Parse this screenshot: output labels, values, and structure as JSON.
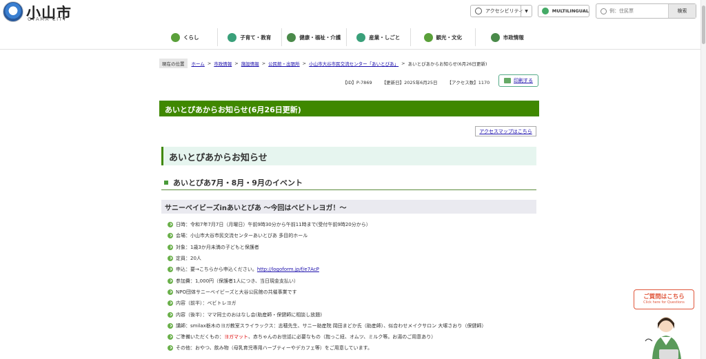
{
  "header": {
    "site_name": "小山市",
    "site_sub": "OYAMA CITY",
    "accessibility": "アクセシビリティ",
    "multilingual": "MULTILINGUAL",
    "search_placeholder": "例：住民票",
    "search_button": "検索"
  },
  "gnav": [
    {
      "label": "くらし",
      "icon": "home-icon"
    },
    {
      "label": "子育て・教育",
      "icon": "child-icon"
    },
    {
      "label": "健康・福祉・介護",
      "icon": "health-icon"
    },
    {
      "label": "産業・しごと",
      "icon": "briefcase-icon"
    },
    {
      "label": "観光・文化",
      "icon": "camera-icon"
    },
    {
      "label": "市政情報",
      "icon": "info-icon"
    }
  ],
  "breadcrumb": {
    "current_label": "現在の位置",
    "items": [
      "ホーム",
      "市政情報",
      "施設情報",
      "公民館・出張所",
      "小山市大谷市民交流センター「あいとぴあ」"
    ],
    "last": "あいとぴあからお知らせ(6月26日更新)"
  },
  "meta": {
    "id": "【ID】P-7869",
    "updated": "【更新日】2025年6月25日",
    "access": "【アクセス数】1170"
  },
  "print_label": "印刷する",
  "page_title": "あいとぴあからお知らせ(6月26日更新)",
  "map_link": "アクセスマップはこちら",
  "h2": "あいとぴあからお知らせ",
  "h3": "あいとぴあ7月・8月・9月のイベント",
  "h4": "サニーベイビーズinあいとぴあ ～今回はベビトレヨガ！～",
  "list": {
    "i0": "日時：令和7年7月7日（月曜日）午前9時30分から午前11時まで(受付午前9時20分から）",
    "i1": "会場：小山市大谷市民交流センターあいとぴあ 多目的ホール",
    "i2": "対象：1歳3か月未満の子どもと保護者",
    "i3": "定員：20人",
    "i4_pre": "申込：要→こちらから申込ください。",
    "i4_link": "http://logoform.jp/f/e7AcP",
    "i5": "参加費：1,000円（保護者1人につき、当日現金支払い）",
    "i6": "NPO団体サニーベイビーズと大谷公民館の共催事業です",
    "i7": "内容（前半）：ベビトレヨガ",
    "i8": "内容（後半）：ママ同士のおはなし会(助産師・保健師に相談し放題)",
    "i9": "講師：smilax栃木のヨガ教室スライラックス：志穂先生、サニー助産院 岡田まどか氏（助産師）、似合わせメイクサロン 大塚さおり（保健師）",
    "i10_pre": "ご準備いただくもの：",
    "i10_red": "ヨガマット",
    "i10_post": "、赤ちゃんのお世話に必要なもの（抱っこ紐、オムツ、ミルク等。お湯のご用意あり）",
    "i11": "その他：おやつ、飲み物（母乳育児専用ハーブティーやデカフェ等）をご用意しています。"
  },
  "question": {
    "title": "ご質問はこちら",
    "sub": "Click here for Questions"
  }
}
